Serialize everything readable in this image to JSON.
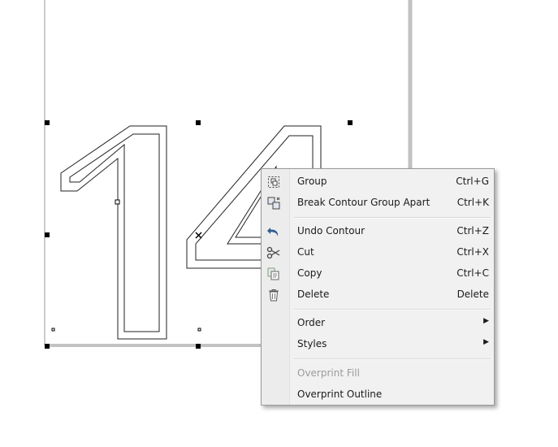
{
  "context_menu": {
    "items": [
      {
        "label": "Group",
        "shortcut": "Ctrl+G",
        "icon": "group-icon"
      },
      {
        "label": "Break Contour Group Apart",
        "shortcut": "Ctrl+K",
        "icon": "break-apart-icon"
      },
      {
        "label": "Undo Contour",
        "shortcut": "Ctrl+Z",
        "icon": "undo-icon"
      },
      {
        "label": "Cut",
        "shortcut": "Ctrl+X",
        "icon": "scissors-icon"
      },
      {
        "label": "Copy",
        "shortcut": "Ctrl+C",
        "icon": "copy-icon"
      },
      {
        "label": "Delete",
        "shortcut": "Delete",
        "icon": "trash-icon"
      },
      {
        "label": "Order",
        "submenu": true
      },
      {
        "label": "Styles",
        "submenu": true
      },
      {
        "label": "Overprint Fill",
        "disabled": true
      },
      {
        "label": "Overprint Outline"
      }
    ]
  },
  "colors": {
    "menu_background": "#f1f1f1",
    "menu_border": "#9a9a9a",
    "disabled_text": "#9b9b9b",
    "page_border": "#c8c8c8"
  }
}
